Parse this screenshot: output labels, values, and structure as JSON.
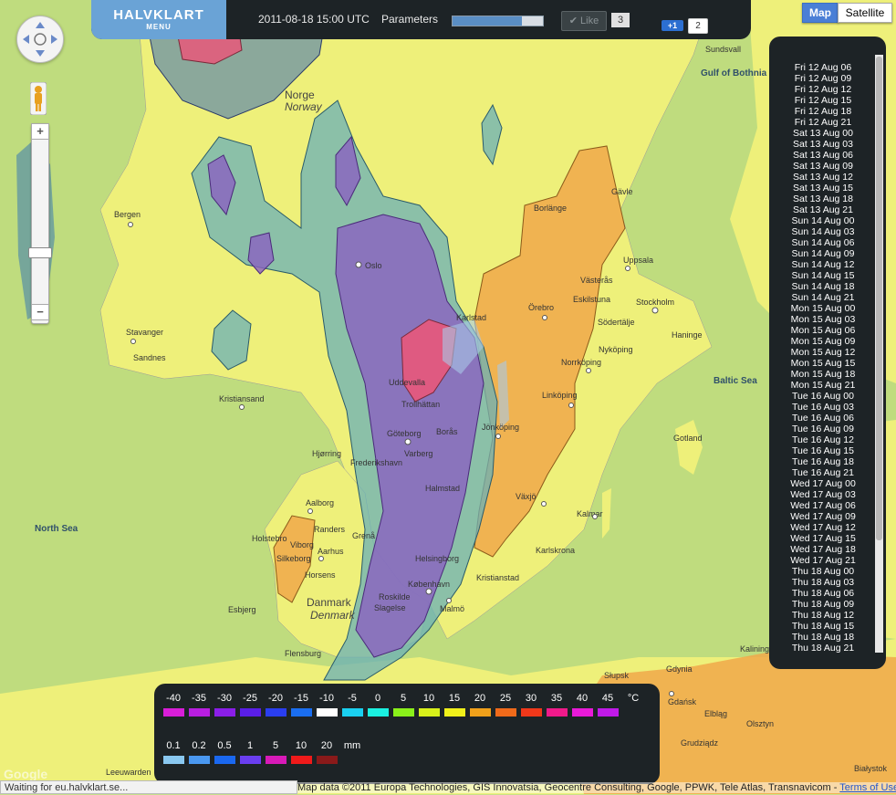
{
  "header": {
    "brand": "HALVKLART",
    "menu_label": "MENU",
    "datetime": "2011-08-18 15:00 UTC",
    "parameters_label": "Parameters",
    "progress_fraction": 0.77,
    "like_label": "Like",
    "like_count": "3",
    "plusone_label": "+1",
    "plusone_count": "2"
  },
  "maptype": {
    "map_label": "Map",
    "satellite_label": "Satellite",
    "active": "Map"
  },
  "zoom": {
    "in_label": "+",
    "out_label": "−"
  },
  "dates": [
    "Fri 12 Aug 06",
    "Fri 12 Aug 09",
    "Fri 12 Aug 12",
    "Fri 12 Aug 15",
    "Fri 12 Aug 18",
    "Fri 12 Aug 21",
    "Sat 13 Aug 00",
    "Sat 13 Aug 03",
    "Sat 13 Aug 06",
    "Sat 13 Aug 09",
    "Sat 13 Aug 12",
    "Sat 13 Aug 15",
    "Sat 13 Aug 18",
    "Sat 13 Aug 21",
    "Sun 14 Aug 00",
    "Sun 14 Aug 03",
    "Sun 14 Aug 06",
    "Sun 14 Aug 09",
    "Sun 14 Aug 12",
    "Sun 14 Aug 15",
    "Sun 14 Aug 18",
    "Sun 14 Aug 21",
    "Mon 15 Aug 00",
    "Mon 15 Aug 03",
    "Mon 15 Aug 06",
    "Mon 15 Aug 09",
    "Mon 15 Aug 12",
    "Mon 15 Aug 15",
    "Mon 15 Aug 18",
    "Mon 15 Aug 21",
    "Tue 16 Aug 00",
    "Tue 16 Aug 03",
    "Tue 16 Aug 06",
    "Tue 16 Aug 09",
    "Tue 16 Aug 12",
    "Tue 16 Aug 15",
    "Tue 16 Aug 18",
    "Tue 16 Aug 21",
    "Wed 17 Aug 00",
    "Wed 17 Aug 03",
    "Wed 17 Aug 06",
    "Wed 17 Aug 09",
    "Wed 17 Aug 12",
    "Wed 17 Aug 15",
    "Wed 17 Aug 18",
    "Wed 17 Aug 21",
    "Thu 18 Aug 00",
    "Thu 18 Aug 03",
    "Thu 18 Aug 06",
    "Thu 18 Aug 09",
    "Thu 18 Aug 12",
    "Thu 18 Aug 15",
    "Thu 18 Aug 18",
    "Thu 18 Aug 21"
  ],
  "legend": {
    "temperature": {
      "unit": "°C",
      "labels": [
        "-40",
        "-35",
        "-30",
        "-25",
        "-20",
        "-15",
        "-10",
        "-5",
        "0",
        "5",
        "10",
        "15",
        "20",
        "25",
        "30",
        "35",
        "40",
        "45"
      ],
      "colors": [
        "#d81ed8",
        "#b81ee0",
        "#8a1ee8",
        "#5a1ee8",
        "#2a3ef0",
        "#1a6ef0",
        "#ffffff",
        "#1ad0f0",
        "#1af0e0",
        "#8af01a",
        "#d8f01a",
        "#f0f01a",
        "#f0a01a",
        "#f06a1a",
        "#f0381a",
        "#f01a8a",
        "#e81ad8",
        "#c01ae8"
      ]
    },
    "precipitation": {
      "unit": "mm",
      "labels": [
        "0.1",
        "0.2",
        "0.5",
        "1",
        "5",
        "10",
        "20"
      ],
      "colors": [
        "#8ac8f0",
        "#4a98f0",
        "#1a68f0",
        "#6a3ef0",
        "#d81ab8",
        "#f01a1a",
        "#8a1a1a"
      ]
    }
  },
  "map_labels": {
    "sundsvall": "Sundsvall",
    "gulf_of_bothnia": "Gulf of Bothnia",
    "norge": "Norge",
    "norway": "Norway",
    "bergen": "Bergen",
    "oslo": "Oslo",
    "stavanger": "Stavanger",
    "sandnes": "Sandnes",
    "kristiansand": "Kristiansand",
    "borlange": "Borlänge",
    "gavle": "Gävle",
    "uppsala": "Uppsala",
    "vasteras": "Västerås",
    "eskilstuna": "Eskilstuna",
    "stockholm": "Stockholm",
    "orebro": "Örebro",
    "sodertalje": "Södertälje",
    "haninge": "Haninge",
    "nykoping": "Nyköping",
    "norrkoping": "Norrköping",
    "linkoping": "Linköping",
    "baltic_sea": "Baltic Sea",
    "karlstad": "Karlstad",
    "uddevalla": "Uddevalla",
    "trollhattan": "Trollhättan",
    "goteborg": "Göteborg",
    "boras": "Borås",
    "jonkoping": "Jönköping",
    "gotland": "Gotland",
    "varberg": "Varberg",
    "vaxjo": "Växjö",
    "halmstad": "Halmstad",
    "kalmar": "Kalmar",
    "karlskrona": "Karlskrona",
    "kristianstad": "Kristianstad",
    "helsingborg": "Helsingborg",
    "kobenhavn": "København",
    "malmo": "Malmö",
    "roskilde": "Roskilde",
    "hjorring": "Hjørring",
    "frederikshavn": "Frederikshavn",
    "aalborg": "Aalborg",
    "north_sea": "North Sea",
    "holstebro": "Holstebro",
    "viborg": "Viborg",
    "randers": "Randers",
    "aarhus": "Aarhus",
    "silkeborg": "Silkeborg",
    "horsens": "Horsens",
    "esbjerg": "Esbjerg",
    "danmark": "Danmark",
    "denmark": "Denmark",
    "flensburg": "Flensburg",
    "slagelse": "Slagelse",
    "gdynia": "Gdynia",
    "gdansk": "Gdańsk",
    "elblag": "Elbląg",
    "slupsk": "Słupsk",
    "olsztyn": "Olsztyn",
    "kaliningrad": "Kaliningrad",
    "grudziadz": "Grudziądz",
    "bialystok": "Białystok",
    "leeuwarden": "Leeuwarden",
    "grena": "Grenå"
  },
  "status_text": "Waiting for eu.halvklart.se...",
  "copyright": {
    "text": "Map data ©2011 Europa Technologies, GIS Innovatsia, Geocentre Consulting, Google, PPWK, Tele Atlas, Transnavicom - ",
    "terms": "Terms of Use"
  },
  "google_label": "Google"
}
